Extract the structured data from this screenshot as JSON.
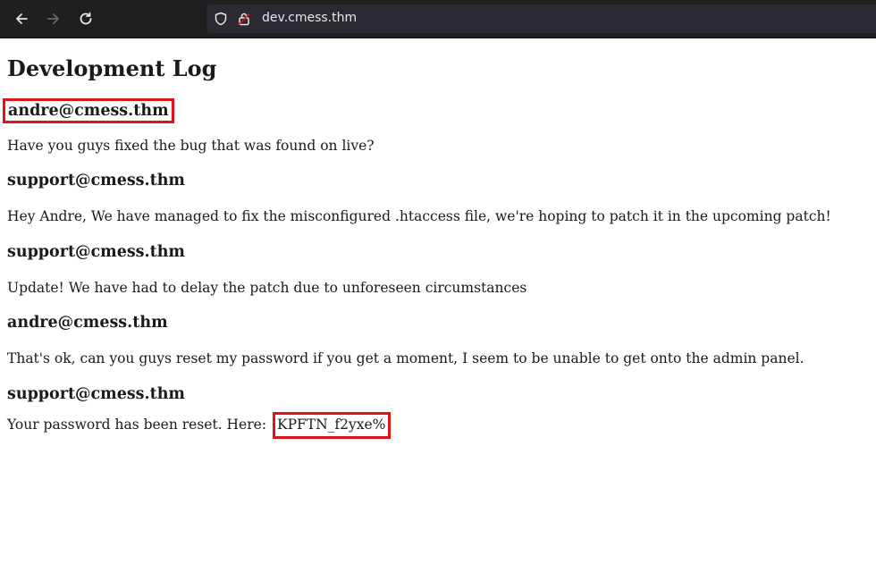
{
  "browser": {
    "url": "dev.cmess.thm",
    "icons": {
      "back": "arrow-left-icon",
      "forward": "arrow-right-icon",
      "reload": "reload-icon",
      "shield": "shield-icon",
      "lock": "lock-icon"
    }
  },
  "page": {
    "title": "Development Log",
    "entries": [
      {
        "author": "andre@cmess.thm",
        "message": "Have you guys fixed the bug that was found on live?"
      },
      {
        "author": "support@cmess.thm",
        "message": "Hey Andre, We have managed to fix the misconfigured .htaccess file, we're hoping to patch it in the upcoming patch!"
      },
      {
        "author": "support@cmess.thm",
        "message": "Update! We have had to delay the patch due to unforeseen circumstances"
      },
      {
        "author": "andre@cmess.thm",
        "message": "That's ok, can you guys reset my password if you get a moment, I seem to be unable to get onto the admin panel."
      },
      {
        "author": "support@cmess.thm",
        "message": "Your password has been reset. Here:",
        "password": "KPFTN_f2yxe%"
      }
    ]
  },
  "colors": {
    "highlight": "#e0131a",
    "toolbar": "#1f1f1f",
    "urlbar": "#2b2a33"
  }
}
